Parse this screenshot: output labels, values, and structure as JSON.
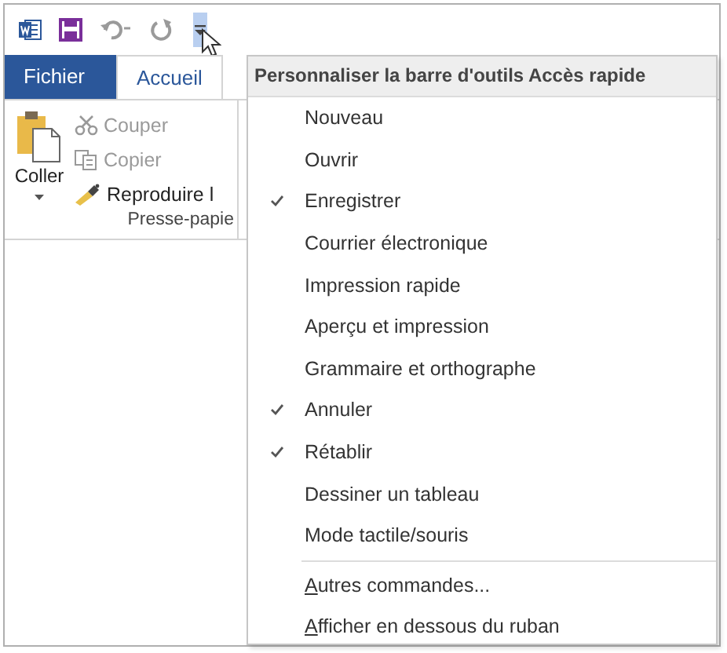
{
  "quick_access": [
    {
      "kind": "word"
    },
    {
      "kind": "save"
    },
    {
      "kind": "undo"
    },
    {
      "kind": "redo"
    },
    {
      "kind": "customize",
      "selected": true
    }
  ],
  "tabs": [
    {
      "label": "Fichier",
      "kind": "file",
      "selected": false
    },
    {
      "label": "Accueil",
      "kind": "tab",
      "selected": true
    }
  ],
  "clipboard": {
    "paste": "Coller",
    "items": [
      {
        "label": "Couper",
        "kind": "cut",
        "disabled": true
      },
      {
        "label": "Copier",
        "kind": "copy",
        "disabled": true
      },
      {
        "label": "Reproduire l",
        "kind": "format",
        "disabled": false
      }
    ],
    "group_label": "Presse-papie"
  },
  "menu": {
    "title": "Personnaliser la barre d'outils Accès rapide",
    "items": [
      {
        "label": "Nouveau",
        "checked": false
      },
      {
        "label": "Ouvrir",
        "checked": false
      },
      {
        "label": "Enregistrer",
        "checked": true
      },
      {
        "label": "Courrier électronique",
        "checked": false
      },
      {
        "label": "Impression rapide",
        "checked": false
      },
      {
        "label": "Aperçu et impression",
        "checked": false
      },
      {
        "label": "Grammaire et orthographe",
        "checked": false
      },
      {
        "label": "Annuler",
        "checked": true
      },
      {
        "label": "Rétablir",
        "checked": true
      },
      {
        "label": "Dessiner un tableau",
        "checked": false
      },
      {
        "label": "Mode tactile/souris",
        "checked": false
      }
    ],
    "commands": [
      {
        "label": "Autres commandes...",
        "mnemonic_underlined": true
      },
      {
        "label": "Afficher en dessous du ruban",
        "mnemonic_underlined": true
      }
    ]
  }
}
